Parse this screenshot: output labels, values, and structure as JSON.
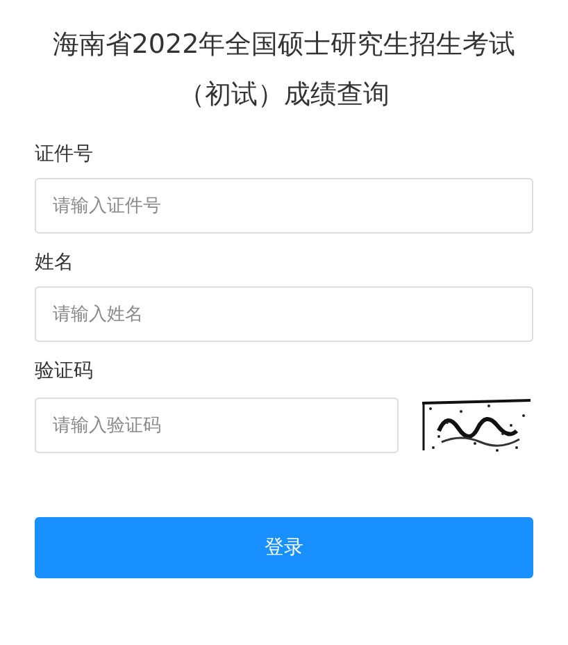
{
  "title_lines": [
    "海南省2022年全国硕士研究生招生考试",
    "（初试）成绩查询"
  ],
  "fields": [
    {
      "kind": "text",
      "label": "证件号",
      "placeholder": "请输入证件号"
    },
    {
      "kind": "text",
      "label": "姓名",
      "placeholder": "请输入姓名"
    },
    {
      "kind": "captcha",
      "label": "验证码",
      "placeholder": "请输入验证码"
    }
  ],
  "submit": "登录"
}
